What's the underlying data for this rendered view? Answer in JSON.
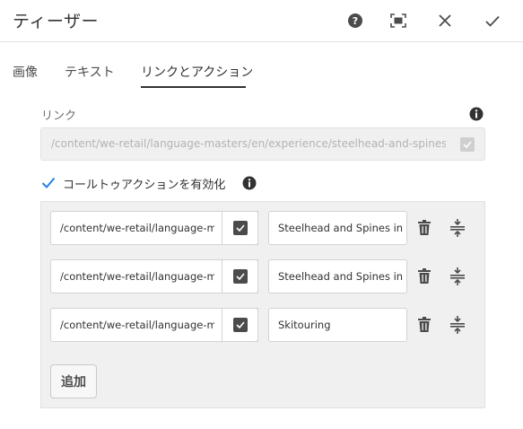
{
  "dialog": {
    "title": "ティーザー",
    "actions": [
      "help-icon",
      "fullscreen-icon",
      "close-icon",
      "done-check-icon"
    ]
  },
  "tabs": [
    {
      "label": "画像",
      "active": false
    },
    {
      "label": "テキスト",
      "active": false
    },
    {
      "label": "リンクとアクション",
      "active": true
    }
  ],
  "link": {
    "label": "リンク",
    "value": "/content/we-retail/language-masters/en/experience/steelhead-and-spines-in-alask",
    "checked": true,
    "disabled": true
  },
  "cta": {
    "label": "コールトゥアクションを有効化",
    "enabled": true,
    "items": [
      {
        "path": "/content/we-retail/language-masters",
        "title": "Steelhead and Spines in Alaska"
      },
      {
        "path": "/content/we-retail/language-masters",
        "title": "Steelhead and Spines in Alaska"
      },
      {
        "path": "/content/we-retail/language-masters",
        "title": "Skitouring"
      }
    ],
    "add_label": "追加"
  },
  "colors": {
    "accent": "#2680eb",
    "text": "#323232",
    "panel_bg": "#f0f0f0"
  }
}
